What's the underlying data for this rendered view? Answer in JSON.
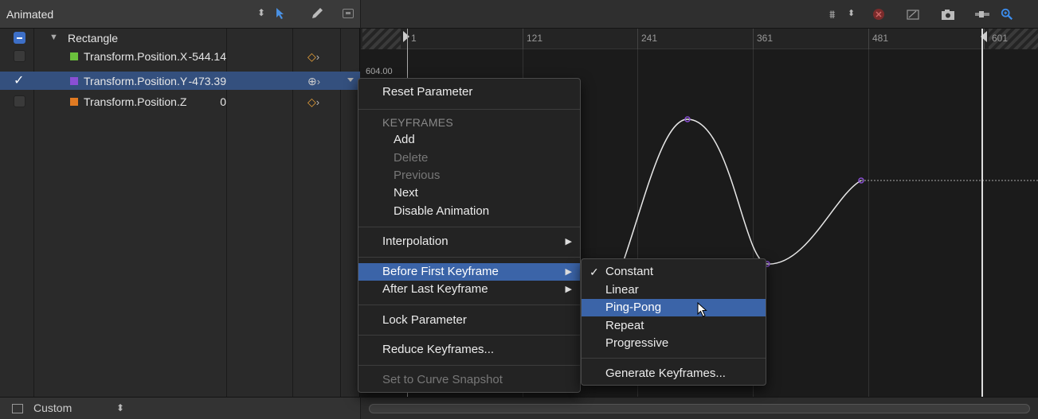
{
  "left_panel": {
    "title": "Animated",
    "rows": [
      {
        "label": "Rectangle",
        "value": "",
        "checked": "minus"
      },
      {
        "label": "Transform.Position.X",
        "value": "-544.14",
        "color": "#6ac13c"
      },
      {
        "label": "Transform.Position.Y",
        "value": "-473.39",
        "color": "#8a4fd4",
        "selected": true
      },
      {
        "label": "Transform.Position.Z",
        "value": "0",
        "color": "#e07a22"
      }
    ],
    "footer_label": "Custom"
  },
  "curve_editor": {
    "ruler_labels": [
      "1",
      "121",
      "241",
      "361",
      "481",
      "601"
    ],
    "y_axis_label": "604.00"
  },
  "context_menu": {
    "items": [
      {
        "label": "Reset Parameter",
        "kind": "item"
      },
      {
        "label": "KEYFRAMES",
        "kind": "header"
      },
      {
        "label": "Add",
        "kind": "indent"
      },
      {
        "label": "Delete",
        "kind": "indent-disabled"
      },
      {
        "label": "Previous",
        "kind": "indent-disabled"
      },
      {
        "label": "Next",
        "kind": "indent"
      },
      {
        "label": "Disable Animation",
        "kind": "indent"
      },
      {
        "label": "Interpolation",
        "kind": "submenu"
      },
      {
        "label": "Before First Keyframe",
        "kind": "submenu-highlight"
      },
      {
        "label": "After Last Keyframe",
        "kind": "submenu"
      },
      {
        "label": "Lock Parameter",
        "kind": "item"
      },
      {
        "label": "Reduce Keyframes...",
        "kind": "item"
      },
      {
        "label": "Set to Curve Snapshot",
        "kind": "disabled"
      }
    ]
  },
  "submenu": {
    "checkmark": "✓",
    "items": [
      {
        "label": "Constant",
        "checked": true
      },
      {
        "label": "Linear"
      },
      {
        "label": "Ping-Pong",
        "highlighted": true
      },
      {
        "label": "Repeat"
      },
      {
        "label": "Progressive"
      },
      {
        "label": "Generate Keyframes..."
      }
    ]
  },
  "colors": {
    "accent": "#3b64a8",
    "curve": "#e8e8e8",
    "keyframe_point": "#8a4fd4"
  }
}
